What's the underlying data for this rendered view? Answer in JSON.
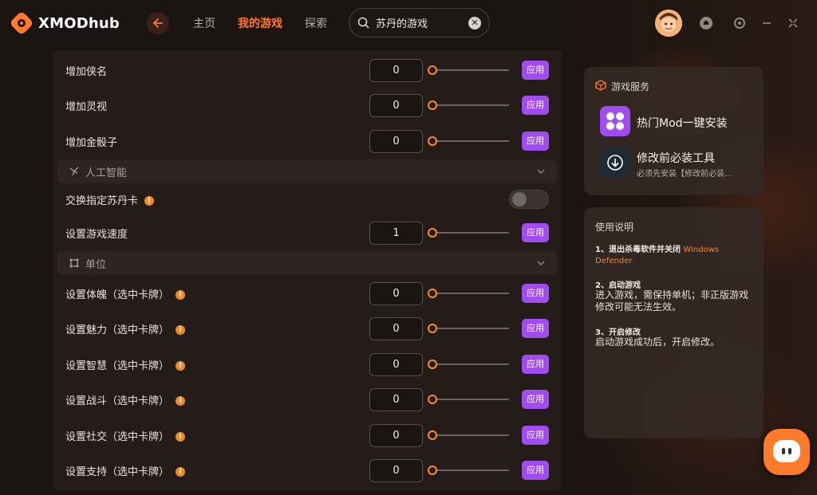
{
  "app": {
    "name": "XMODhub"
  },
  "nav": {
    "items": [
      {
        "label": "主页",
        "active": false
      },
      {
        "label": "我的游戏",
        "active": true
      },
      {
        "label": "探索",
        "active": false
      }
    ]
  },
  "search": {
    "value": "苏丹的游戏"
  },
  "rows_top": [
    {
      "label": "增加侠名",
      "value": "0",
      "apply": "应用"
    },
    {
      "label": "增加灵视",
      "value": "0",
      "apply": "应用"
    },
    {
      "label": "增加金骰子",
      "value": "0",
      "apply": "应用"
    }
  ],
  "section_ai": {
    "label": "人工智能"
  },
  "toggle_row": {
    "label": "交换指定苏丹卡",
    "enabled": false
  },
  "speed_row": {
    "label": "设置游戏速度",
    "value": "1",
    "apply": "应用"
  },
  "section_unit": {
    "label": "单位"
  },
  "rows_unit": [
    {
      "label": "设置体魄（选中卡牌）",
      "value": "0",
      "apply": "应用"
    },
    {
      "label": "设置魅力（选中卡牌）",
      "value": "0",
      "apply": "应用"
    },
    {
      "label": "设置智慧（选中卡牌）",
      "value": "0",
      "apply": "应用"
    },
    {
      "label": "设置战斗（选中卡牌）",
      "value": "0",
      "apply": "应用"
    },
    {
      "label": "设置社交（选中卡牌）",
      "value": "0",
      "apply": "应用"
    },
    {
      "label": "设置支持（选中卡牌）",
      "value": "0",
      "apply": "应用"
    }
  ],
  "services": {
    "title": "游戏服务",
    "items": [
      {
        "title": "热门Mod一键安装",
        "sub": ""
      },
      {
        "title": "修改前必装工具",
        "sub": "必须先安装【修改前必装..."
      }
    ]
  },
  "manual": {
    "title": "使用说明",
    "steps": [
      {
        "head": "1、退出杀毒软件并关闭",
        "highlight": "Windows Defender",
        "body": ""
      },
      {
        "head": "2、启动游戏",
        "highlight": "",
        "body": "进入游戏，需保持单机；非正版游戏修改可能无法生效。"
      },
      {
        "head": "3、开启修改",
        "highlight": "",
        "body": "启动游戏成功后，开启修改。"
      }
    ]
  },
  "colors": {
    "accent": "#ff7a2a",
    "apply": "#a14cf0",
    "info": "#f08a2a"
  }
}
